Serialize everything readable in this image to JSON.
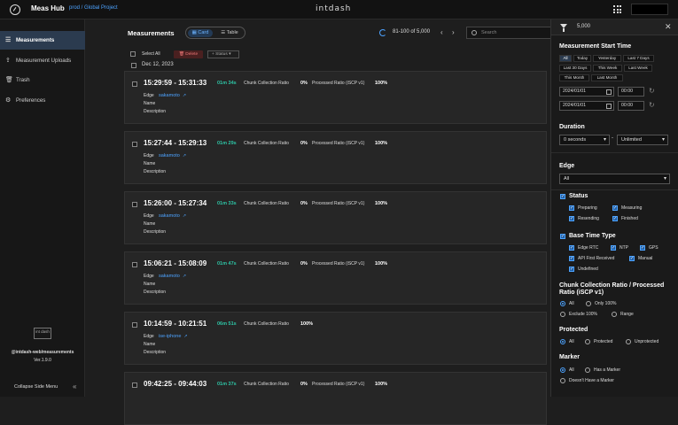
{
  "header": {
    "app_title": "Meas Hub",
    "breadcrumb": "prod / Global Project",
    "logo_text": "intdash"
  },
  "sidebar": {
    "items": [
      {
        "label": "Measurements",
        "icon": "menu-icon"
      },
      {
        "label": "Measurement Uploads",
        "icon": "upload-icon"
      },
      {
        "label": "Trash",
        "icon": "trash-icon"
      },
      {
        "label": "Preferences",
        "icon": "gear-icon"
      }
    ],
    "logo_text": "int dash",
    "package": "@intdash-web/measurements",
    "version": "Ver.1.9.0",
    "collapse_label": "Collapse Side Menu"
  },
  "main": {
    "title": "Measurements",
    "view_card": "Card",
    "view_table": "Table",
    "range": "81-100 of 5,000",
    "search_placeholder": "Search",
    "select_all": "Select All",
    "delete_label": "Delete",
    "status_label": "Status",
    "date_header": "Dec 12, 2023",
    "labels": {
      "edge": "Edge",
      "name": "Name",
      "description": "Description",
      "ccr": "Chunk Collection Ratio",
      "prr": "Processed Ratio (iSCP v1)"
    },
    "cards": [
      {
        "time": "15:29:59 - 15:31:33",
        "duration": "01m 34s",
        "ccr": "0%",
        "prr": "100%",
        "edge": "sakamoto"
      },
      {
        "time": "15:27:44 - 15:29:13",
        "duration": "01m 29s",
        "ccr": "0%",
        "prr": "100%",
        "edge": "sakamoto"
      },
      {
        "time": "15:26:00 - 15:27:34",
        "duration": "01m 33s",
        "ccr": "0%",
        "prr": "100%",
        "edge": "sakamoto"
      },
      {
        "time": "15:06:21 - 15:08:09",
        "duration": "01m 47s",
        "ccr": "0%",
        "prr": "100%",
        "edge": "sakamoto"
      },
      {
        "time": "10:14:59 - 10:21:51",
        "duration": "06m 51s",
        "ccr": "100%",
        "prr": "",
        "edge": "ise-iphone"
      },
      {
        "time": "09:42:25 - 09:44:03",
        "duration": "01m 37s",
        "ccr": "0%",
        "prr": "100%",
        "edge": ""
      }
    ]
  },
  "filter": {
    "count": "5,000",
    "start_title": "Measurement Start Time",
    "chips": [
      "All",
      "Today",
      "Yesterday",
      "Last 7 Days",
      "Last 30 Days",
      "This Week",
      "Last Week",
      "This Month",
      "Last Month"
    ],
    "date_from": "2024/01/01",
    "time_from": "00:00",
    "date_to": "2024/01/01",
    "time_to": "00:00",
    "duration_title": "Duration",
    "duration_min": "0 seconds",
    "duration_max": "Unlimited",
    "edge_title": "Edge",
    "edge_value": "All",
    "status_title": "Status",
    "status_items": [
      "Preparing",
      "Measuring",
      "Resending",
      "Finished"
    ],
    "basetime_title": "Base Time Type",
    "basetime_items": [
      "Edge RTC",
      "NTP",
      "GPS",
      "API First Received",
      "Manual",
      "Undefined"
    ],
    "ratio_title": "Chunk Collection Ratio / Processed Ratio (iSCP v1)",
    "ratio_options": [
      "All",
      "Only 100%",
      "Exclude 100%",
      "Range"
    ],
    "protected_title": "Protected",
    "protected_options": [
      "All",
      "Protected",
      "Unprotected"
    ],
    "marker_title": "Marker",
    "marker_options": [
      "All",
      "Has a Marker",
      "Doesn't Have a Marker"
    ]
  }
}
